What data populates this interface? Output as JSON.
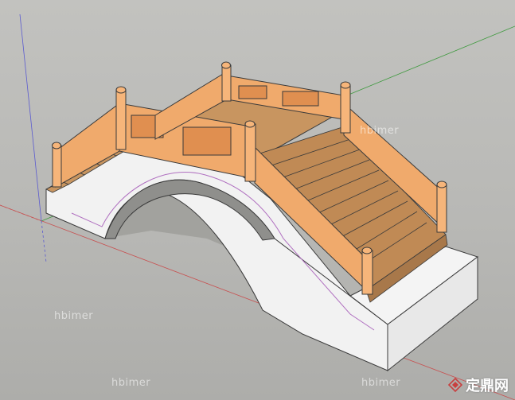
{
  "viewport": {
    "background": "#b9b9b6",
    "axis_colors": {
      "red": "#c85050",
      "green": "#3f9a3f",
      "blue": "#5a5ad0"
    }
  },
  "model": {
    "wall_color": "#f2f2f2",
    "deck_color": "#c89560",
    "rail_color": "#f0aa6c",
    "edge_color": "#3a3a3a",
    "soffit_color": "#8f8f8c"
  },
  "watermarks": {
    "mid": "hbimer",
    "bottom_left": "hbimer",
    "bottom_center": "hbimer",
    "bottom_right": "hbimer"
  },
  "logo": {
    "text": "定鼎网",
    "icon": "dingding-logo-icon"
  }
}
